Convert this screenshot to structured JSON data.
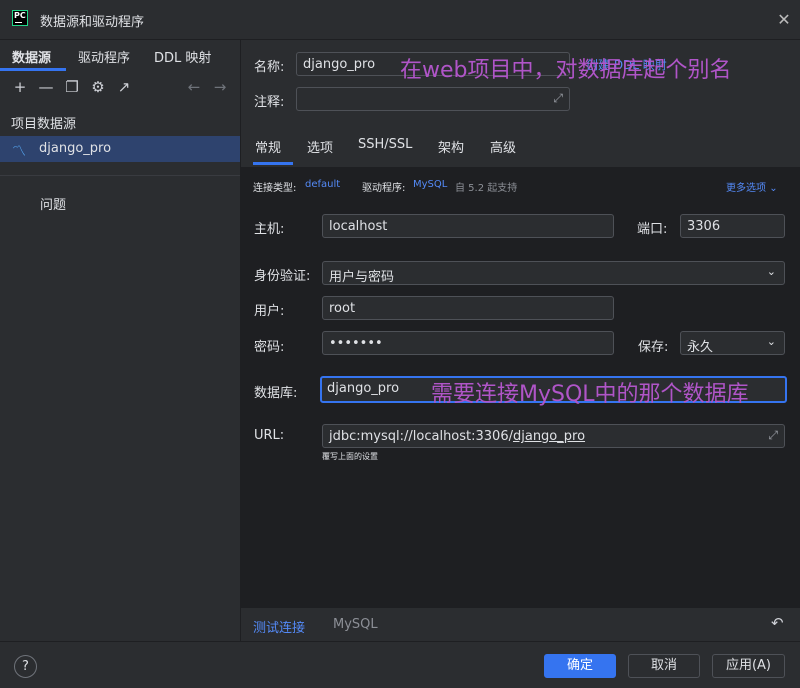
{
  "window": {
    "title": "数据源和驱动程序",
    "close": "✕"
  },
  "left": {
    "tabs": [
      "数据源",
      "驱动程序",
      "DDL 映射"
    ],
    "section_title": "项目数据源",
    "datasource": "django_pro",
    "problems": "问题"
  },
  "form": {
    "name_label": "名称:",
    "name_value": "django_pro",
    "create_ddl_label": "创建 DDL 映射",
    "comment_label": "注释:",
    "comment_value": "",
    "tabs": [
      "常规",
      "选项",
      "SSH/SSL",
      "架构",
      "高级"
    ],
    "conn_type_label": "连接类型:",
    "conn_type_value": "default",
    "driver_label": "驱动程序:",
    "driver_value": "MySQL",
    "driver_version": "自 5.2 起支持",
    "more_options": "更多选项",
    "host_label": "主机:",
    "host_value": "localhost",
    "port_label": "端口:",
    "port_value": "3306",
    "auth_label": "身份验证:",
    "auth_value": "用户与密码",
    "user_label": "用户:",
    "user_value": "root",
    "password_label": "密码:",
    "password_value": "•••••••",
    "save_label": "保存:",
    "save_value": "永久",
    "db_label": "数据库:",
    "db_value": "django_pro",
    "url_label": "URL:",
    "url_prefix": "jdbc:mysql://localhost:3306/",
    "url_db": "django_pro",
    "url_hint": "覆写上面的设置"
  },
  "annotations": {
    "alias_note": "在web项目中，对数据库起个别名",
    "db_note": "需要连接MySQL中的那个数据库"
  },
  "bottom": {
    "test_connection": "测试连接",
    "dbms": "MySQL"
  },
  "footer": {
    "help": "?",
    "ok": "确定",
    "cancel": "取消",
    "apply": "应用(A)"
  },
  "colors": {
    "accent": "#3574f0",
    "annotation": "#b055c8",
    "selection": "#2e436e"
  }
}
